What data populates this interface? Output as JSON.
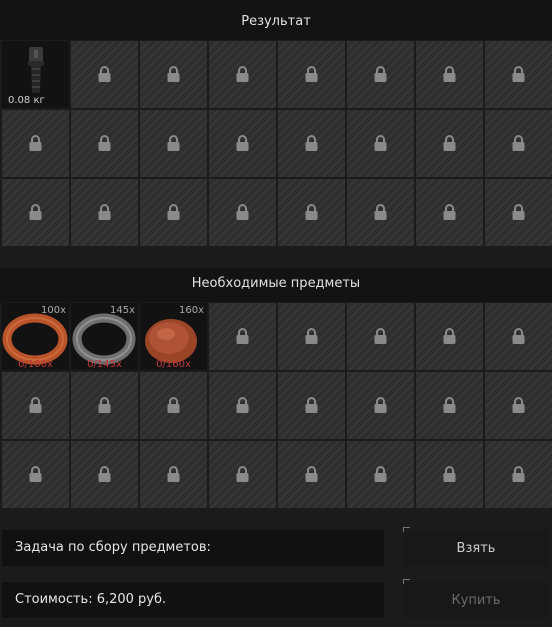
{
  "result_section": {
    "title": "Результат",
    "item": {
      "weight": "0.08 кг",
      "icon": "grip-icon"
    }
  },
  "required_section": {
    "title": "Необходимые предметы",
    "items": [
      {
        "icon": "orange-ring-icon",
        "count": "100x",
        "progress": "0/100x",
        "color": "#b8532a"
      },
      {
        "icon": "gray-ring-icon",
        "count": "145x",
        "progress": "0/145x",
        "color": "#8a8a8a"
      },
      {
        "icon": "copper-disc-icon",
        "count": "160x",
        "progress": "0/160x",
        "color": "#a84c32"
      }
    ]
  },
  "task": {
    "label": "Задача по сбору предметов:"
  },
  "cost": {
    "label": "Стоимость: 6,200 руб."
  },
  "buttons": {
    "take": "Взять",
    "buy": "Купить"
  }
}
